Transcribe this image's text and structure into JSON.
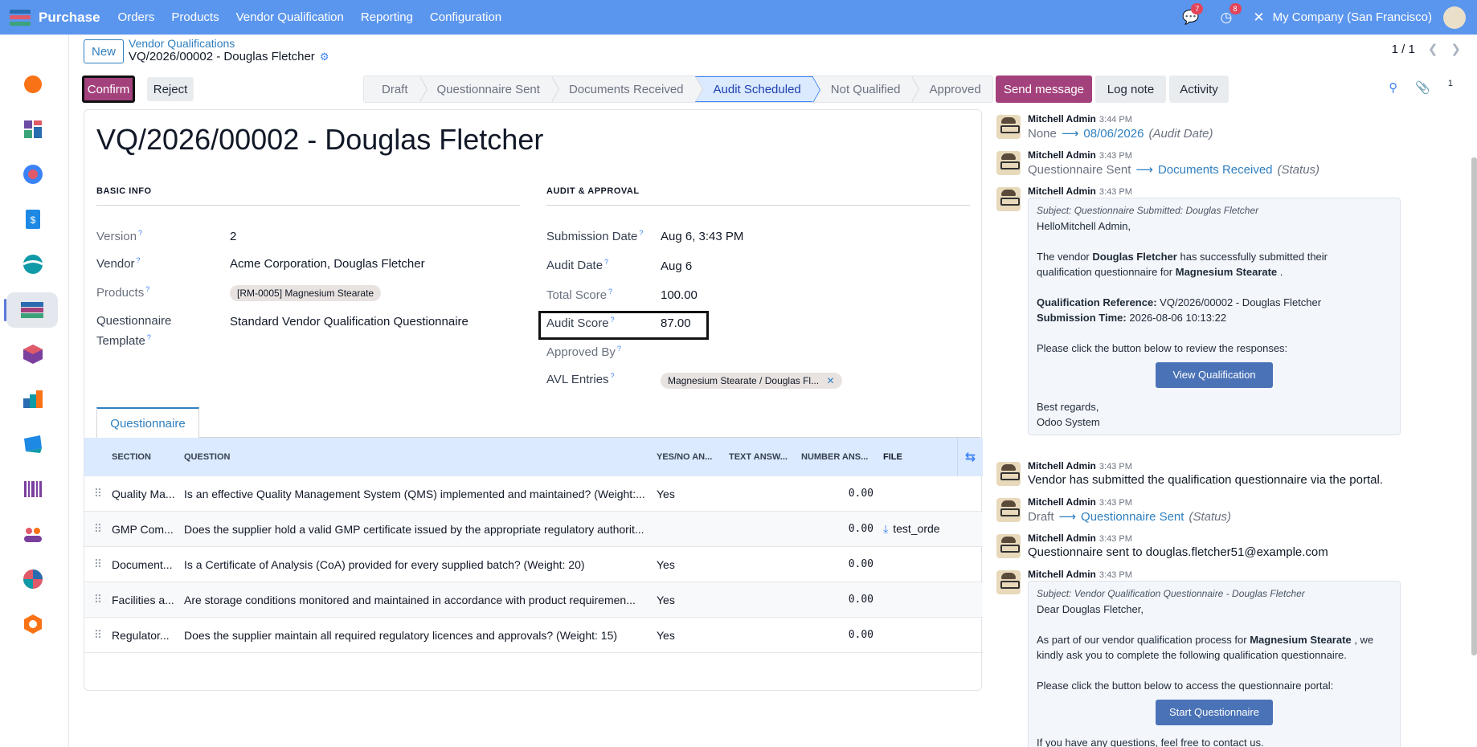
{
  "topbar": {
    "brand": "Purchase",
    "menus": [
      "Orders",
      "Products",
      "Vendor Qualification",
      "Reporting",
      "Configuration"
    ],
    "messages_count": "7",
    "activities_count": "8",
    "company": "My Company (San Francisco)"
  },
  "control": {
    "new_label": "New",
    "breadcrumb_parent": "Vendor Qualifications",
    "breadcrumb_current": "VQ/2026/00002 - Douglas Fletcher",
    "pager": "1 / 1",
    "confirm_label": "Confirm",
    "reject_label": "Reject",
    "stages": [
      "Draft",
      "Questionnaire Sent",
      "Documents Received",
      "Audit Scheduled",
      "Not Qualified",
      "Approved"
    ],
    "active_stage": "Audit Scheduled",
    "send_message_label": "Send message",
    "log_note_label": "Log note",
    "activity_label": "Activity",
    "attachment_count": "1"
  },
  "form": {
    "title": "VQ/2026/00002 - Douglas Fletcher",
    "basic_info_title": "BASIC INFO",
    "audit_title": "AUDIT & APPROVAL",
    "version_label": "Version",
    "version": "2",
    "vendor_label": "Vendor",
    "vendor": "Acme Corporation, Douglas Fletcher",
    "products_label": "Products",
    "product_tag": "[RM-0005] Magnesium Stearate",
    "template_label_1": "Questionnaire",
    "template_label_2": "Template",
    "template": "Standard Vendor Qualification Questionnaire",
    "submission_label": "Submission Date",
    "submission": "Aug 6, 3:43 PM",
    "audit_date_label": "Audit Date",
    "audit_date": "Aug 6",
    "total_score_label": "Total Score",
    "total_score": "100.00",
    "audit_score_label": "Audit Score",
    "audit_score": "87.00",
    "approved_by_label": "Approved By",
    "avl_label": "AVL Entries",
    "avl_tag": "Magnesium Stearate / Douglas Fl..."
  },
  "tabs": {
    "questionnaire": "Questionnaire"
  },
  "table": {
    "headers": {
      "section": "SECTION",
      "question": "QUESTION",
      "yesno": "YES/NO AN...",
      "text": "TEXT ANSW...",
      "number": "NUMBER ANS...",
      "file": "FILE"
    },
    "rows": [
      {
        "section": "Quality Ma...",
        "question": "Is an effective Quality Management System (QMS) implemented and maintained? (Weight:...",
        "yesno": "Yes",
        "text": "",
        "number": "0.00",
        "file": ""
      },
      {
        "section": "GMP Com...",
        "question": "Does the supplier hold a valid GMP certificate issued by the appropriate regulatory authorit...",
        "yesno": "",
        "text": "",
        "number": "0.00",
        "file": "test_orde"
      },
      {
        "section": "Document...",
        "question": "Is a Certificate of Analysis (CoA) provided for every supplied batch? (Weight: 20)",
        "yesno": "Yes",
        "text": "",
        "number": "0.00",
        "file": ""
      },
      {
        "section": "Facilities a...",
        "question": "Are storage conditions monitored and maintained in accordance with product requiremen...",
        "yesno": "Yes",
        "text": "",
        "number": "0.00",
        "file": ""
      },
      {
        "section": "Regulator...",
        "question": "Does the supplier maintain all required regulatory licences and approvals? (Weight: 15)",
        "yesno": "Yes",
        "text": "",
        "number": "0.00",
        "file": ""
      }
    ]
  },
  "chatter": {
    "author": "Mitchell Admin",
    "m1": {
      "time": "3:44 PM",
      "old": "None",
      "new": "08/06/2026",
      "field": "(Audit Date)"
    },
    "m2": {
      "time": "3:43 PM",
      "old": "Questionnaire Sent",
      "new": "Documents Received",
      "field": "(Status)"
    },
    "m3": {
      "time": "3:43 PM",
      "subject": "Subject: Questionnaire Submitted: Douglas Fletcher",
      "greeting": "HelloMitchell Admin,",
      "l1a": "The vendor",
      "l1b": "Douglas Fletcher",
      "l1c": "has successfully submitted their",
      "l2a": "qualification questionnaire for",
      "l2b": "Magnesium Stearate",
      "l2c": ".",
      "ref_label": "Qualification Reference:",
      "ref": "VQ/2026/00002 - Douglas Fletcher",
      "sub_label": "Submission Time:",
      "sub": "2026-08-06 10:13:22",
      "instr": "Please click the button below to review the responses:",
      "button": "View Qualification",
      "regards": "Best regards,",
      "sign": "Odoo System"
    },
    "m4": {
      "time": "3:43 PM",
      "text": "Vendor has submitted the qualification questionnaire via the portal."
    },
    "m5": {
      "time": "3:43 PM",
      "old": "Draft",
      "new": "Questionnaire Sent",
      "field": "(Status)"
    },
    "m6": {
      "time": "3:43 PM",
      "text": "Questionnaire sent to douglas.fletcher51@example.com"
    },
    "m7": {
      "time": "3:43 PM",
      "subject": "Subject: Vendor Qualification Questionnaire - Douglas Fletcher",
      "greeting": "Dear Douglas Fletcher,",
      "l1a": "As part of our vendor qualification process for",
      "l1b": "Magnesium Stearate",
      "l1c": ", we",
      "l2": "kindly ask you to complete the following qualification questionnaire.",
      "instr": "Please click the button below to access the questionnaire portal:",
      "button": "Start Questionnaire",
      "closing": "If you have any questions, feel free to contact us."
    }
  }
}
